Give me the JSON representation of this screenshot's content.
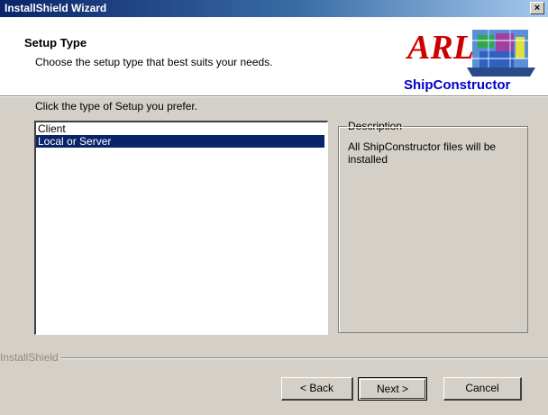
{
  "window": {
    "title": "InstallShield Wizard",
    "close_glyph": "×"
  },
  "header": {
    "title": "Setup Type",
    "subtitle": "Choose the setup type that best suits your needs.",
    "logo_text_top": "ARL",
    "logo_text_bottom": "ShipConstructor",
    "logo_top_color": "#cc0000",
    "logo_bottom_color": "#0000cc"
  },
  "main": {
    "prompt": "Click the type of Setup you prefer.",
    "setup_types": [
      {
        "label": "Client",
        "selected": false
      },
      {
        "label": "Local or Server",
        "selected": true
      }
    ],
    "description": {
      "legend": "Description",
      "text": "All ShipConstructor files will be installed"
    }
  },
  "footer": {
    "brand": "InstallShield",
    "back_label": "< Back",
    "next_label": "Next >",
    "cancel_label": "Cancel"
  },
  "colors": {
    "dialog_bg": "#d4d0c8",
    "title_bar": "#0a246a",
    "selection": "#0a246a"
  }
}
